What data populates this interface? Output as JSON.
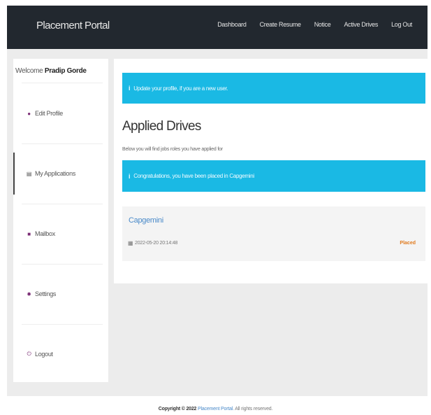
{
  "navbar": {
    "brand": "Placement Portal",
    "links": [
      "Dashboard",
      "Create Resume",
      "Notice",
      "Active Drives",
      "Log Out"
    ]
  },
  "sidebar": {
    "welcome_prefix": "Welcome",
    "user_name": "Pradip Gorde",
    "items": [
      {
        "label": "Edit Profile",
        "icon": "user-icon"
      },
      {
        "label": "My Applications",
        "icon": "list-icon"
      },
      {
        "label": "Mailbox",
        "icon": "envelope-icon"
      },
      {
        "label": "Settings",
        "icon": "gear-icon"
      },
      {
        "label": "Logout",
        "icon": "power-icon"
      }
    ],
    "active_item": "My Applications"
  },
  "main": {
    "alert_profile": "Update your profile, if you are a new user.",
    "title": "Applied Drives",
    "subtitle": "Below you will find jobs roles you have applied for",
    "alert_placed": "Congratulations, you have been placed in Capgemini"
  },
  "drives": [
    {
      "company": "Capgemini",
      "date": "2022-05-20 20:14:48",
      "status": "Placed"
    }
  ],
  "footer": {
    "copyright": "Copyright © 2022",
    "link": "Placement Portal.",
    "rights": "All rights reserved."
  },
  "colors": {
    "navbar": "#22282f",
    "alert": "#1ab9e4",
    "link": "#4a8ac9",
    "status_placed": "#e07a1d",
    "icon_accent": "#7a2c74"
  }
}
